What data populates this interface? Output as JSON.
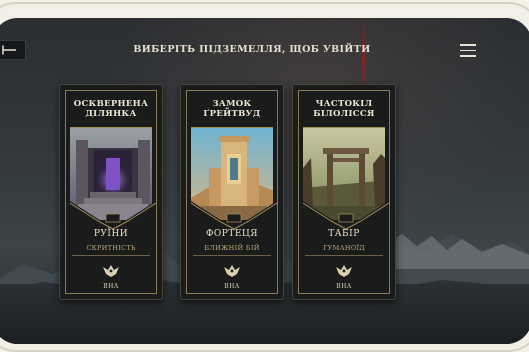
{
  "header": {
    "title": "ВИБЕРІТЬ ПІДЗЕМЕЛЛЯ, ЩОБ УВІЙТИ"
  },
  "icons": {
    "back": "arrow-left-icon",
    "menu": "hamburger-menu-icon",
    "emblem": "bird-emblem-icon"
  },
  "colors": {
    "gold": "#a28c5a",
    "text": "#e8e2d0",
    "card_bg": "#1a1c1c"
  },
  "dungeons": [
    {
      "title": "ОСКВЕРНЕНА\nДІЛЯНКА",
      "type": "РУЇНИ",
      "subtitle": "СКРИТНІСТЬ",
      "button_label": "ВНА"
    },
    {
      "title": "ЗАМОК\nҐРЕЙТВУД",
      "type": "ФОРТЕЦЯ",
      "subtitle": "БЛИЖНІЙ БІЙ",
      "button_label": "ВНА"
    },
    {
      "title": "ЧАСТОКІЛ\nБІЛОЛІССЯ",
      "type": "ТАБІР",
      "subtitle": "ГУМАНОЇД",
      "button_label": "ВНА"
    }
  ]
}
